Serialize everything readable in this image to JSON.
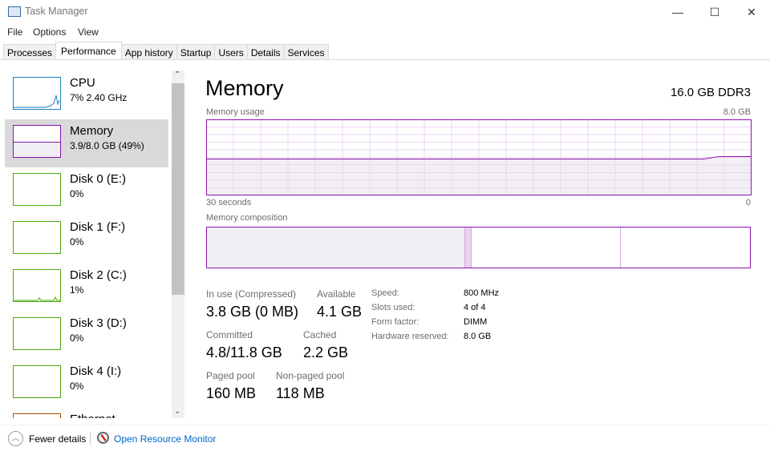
{
  "window": {
    "title": "Task Manager",
    "minimize": "—",
    "maximize": "☐",
    "close": "✕"
  },
  "menu": [
    "File",
    "Options",
    "View"
  ],
  "tabs": [
    "Processes",
    "Performance",
    "App history",
    "Startup",
    "Users",
    "Details",
    "Services"
  ],
  "active_tab": "Performance",
  "sidebar": [
    {
      "name": "CPU",
      "value": "7% 2.40 GHz",
      "color": "#1a7fc1"
    },
    {
      "name": "Memory",
      "value": "3.9/8.0 GB (49%)",
      "color": "#8b12ae",
      "selected": true
    },
    {
      "name": "Disk 0 (E:)",
      "value": "0%",
      "color": "#4da60c"
    },
    {
      "name": "Disk 1 (F:)",
      "value": "0%",
      "color": "#4da60c"
    },
    {
      "name": "Disk 2 (C:)",
      "value": "1%",
      "color": "#4da60c"
    },
    {
      "name": "Disk 3 (D:)",
      "value": "0%",
      "color": "#4da60c"
    },
    {
      "name": "Disk 4 (I:)",
      "value": "0%",
      "color": "#4da60c"
    },
    {
      "name": "Ethernet",
      "value": "",
      "color": "#a74f01"
    }
  ],
  "main": {
    "title": "Memory",
    "spec": "16.0 GB DDR3",
    "usage_label": "Memory usage",
    "usage_max": "8.0 GB",
    "time_label": "30 seconds",
    "time_min": "0",
    "usage_percent": 49,
    "composition_label": "Memory composition",
    "composition_gb": {
      "in_use": 3.8,
      "modified": 0.1,
      "standby": 2.2,
      "free": 1.9
    },
    "stats": {
      "in_use_label": "In use (Compressed)",
      "in_use": "3.8 GB (0 MB)",
      "available_label": "Available",
      "available": "4.1 GB",
      "committed_label": "Committed",
      "committed": "4.8/11.8 GB",
      "cached_label": "Cached",
      "cached": "2.2 GB",
      "paged_label": "Paged pool",
      "paged": "160 MB",
      "nonpaged_label": "Non-paged pool",
      "nonpaged": "118 MB"
    },
    "specs": [
      {
        "k": "Speed:",
        "v": "800 MHz"
      },
      {
        "k": "Slots used:",
        "v": "4 of 4"
      },
      {
        "k": "Form factor:",
        "v": "DIMM"
      },
      {
        "k": "Hardware reserved:",
        "v": "8.0 GB"
      }
    ]
  },
  "footer": {
    "fewer": "Fewer details",
    "monitor": "Open Resource Monitor",
    "link_color": "#0066cc"
  }
}
